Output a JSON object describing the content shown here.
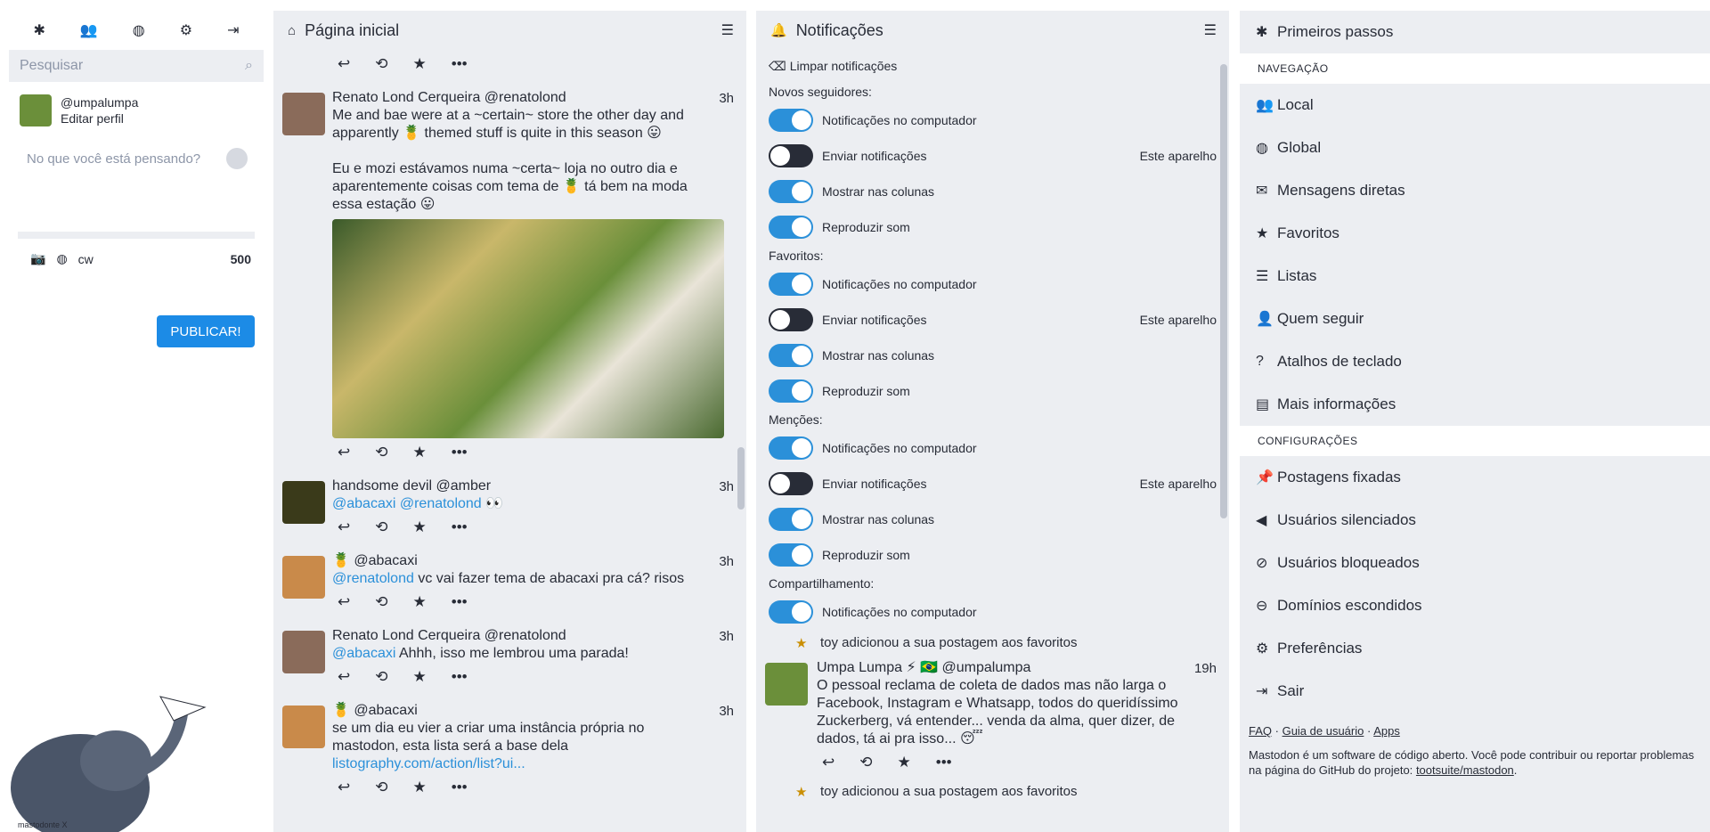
{
  "compose": {
    "search_placeholder": "Pesquisar",
    "username": "@umpalumpa",
    "edit_profile": "Editar perfil",
    "placeholder": "No que você está pensando?",
    "cw": "cw",
    "char_count": "500",
    "publish": "PUBLICAR!",
    "watermark": "mastodonte X"
  },
  "home": {
    "title": "Página inicial",
    "statuses": [
      {
        "name": "Renato Lond Cerqueira @renatolond",
        "time": "3h",
        "line1": "Me and bae were at a ~certain~ store the other day and",
        "line2": "apparently 🍍 themed stuff is quite in this season 😛",
        "line3": "Eu e mozi estávamos numa ~certa~ loja no outro dia e",
        "line4": "aparentemente coisas com tema de 🍍 tá bem na moda",
        "line5": "essa estação 😛"
      },
      {
        "name": "handsome devil @amber",
        "time": "3h",
        "mention1": "@abacaxi",
        "mention2": "@renatolond",
        "tail": "👀"
      },
      {
        "name": "🍍 @abacaxi",
        "time": "3h",
        "mention": "@renatolond",
        "text": "vc vai fazer tema de abacaxi pra cá? risos"
      },
      {
        "name": "Renato Lond Cerqueira @renatolond",
        "time": "3h",
        "mention": "@abacaxi",
        "text": "Ahhh, isso me lembrou uma parada!"
      },
      {
        "name": "🍍 @abacaxi",
        "time": "3h",
        "line1": "se um dia eu vier a criar uma instância própria no",
        "line2": "mastodon, esta lista será a base dela",
        "link": "listography.com/action/list?ui..."
      }
    ]
  },
  "notifications": {
    "title": "Notificações",
    "clear": "Limpar notificações",
    "sections": [
      {
        "title": "Novos seguidores:"
      },
      {
        "title": "Favoritos:"
      },
      {
        "title": "Menções:"
      },
      {
        "title": "Compartilhamento:"
      }
    ],
    "desktop": "Notificações no computador",
    "push": "Enviar notificações",
    "device": "Este aparelho",
    "show": "Mostrar nas colunas",
    "sound": "Reproduzir som",
    "fav1": "toy adicionou a sua postagem aos favoritos",
    "status_name": "Umpa Lumpa ⚡ 🇧🇷 @umpalumpa",
    "status_time": "19h",
    "status_l1": "O pessoal reclama de coleta de dados mas não larga o",
    "status_l2": "Facebook, Instagram e Whatsapp, todos do queridíssimo",
    "status_l3": "Zuckerberg, vá entender... venda da alma, quer dizer, de",
    "status_l4": "dados, tá ai pra isso... 😴",
    "fav2": "toy adicionou a sua postagem aos favoritos"
  },
  "nav": {
    "getting_started": "Primeiros passos",
    "nav_section": "NAVEGAÇÃO",
    "local": "Local",
    "global": "Global",
    "dm": "Mensagens diretas",
    "favourites": "Favoritos",
    "lists": "Listas",
    "follow": "Quem seguir",
    "shortcuts": "Atalhos de teclado",
    "more": "Mais informações",
    "settings_section": "CONFIGURAÇÕES",
    "pinned": "Postagens fixadas",
    "muted": "Usuários silenciados",
    "blocked": "Usuários bloqueados",
    "domains": "Domínios escondidos",
    "prefs": "Preferências",
    "logout": "Sair",
    "faq": "FAQ",
    "guide": "Guia de usuário",
    "apps": "Apps",
    "about": "Mastodon é um software de código aberto. Você pode contribuir ou reportar problemas na página do GitHub do projeto:",
    "repo": "tootsuite/mastodon"
  }
}
